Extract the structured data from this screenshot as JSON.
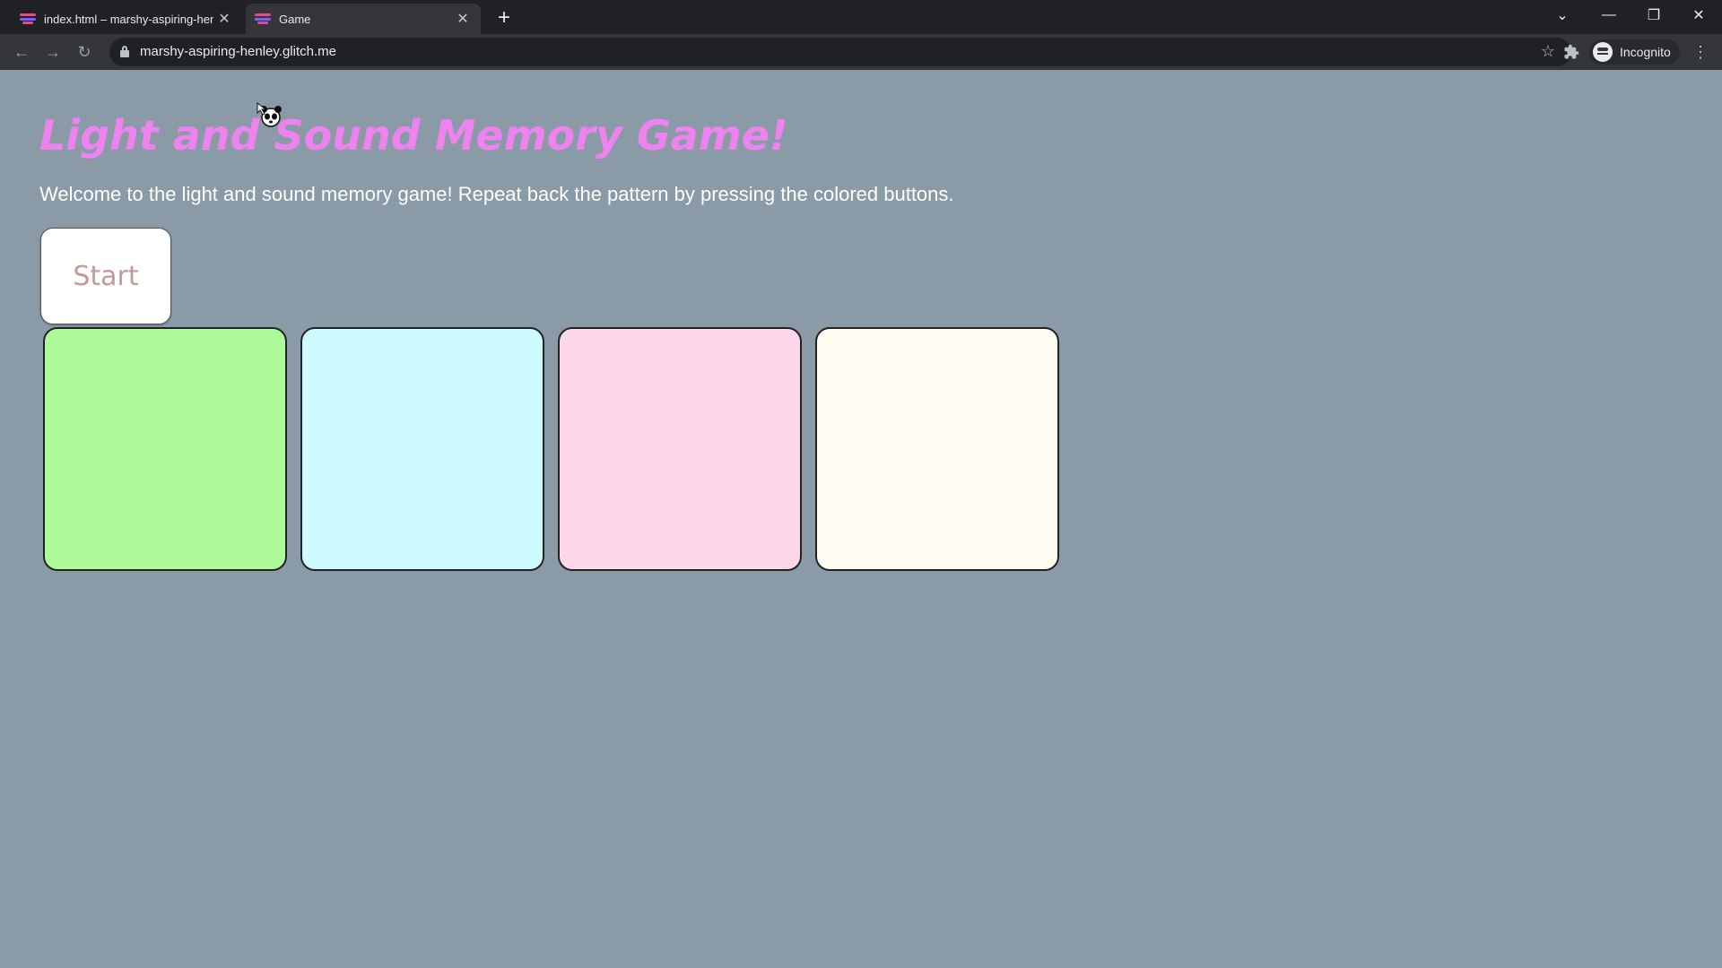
{
  "browser": {
    "tabs": [
      {
        "title": "index.html – marshy-aspiring-henley",
        "active": false
      },
      {
        "title": "Game",
        "active": true
      }
    ],
    "url": "marshy-aspiring-henley.glitch.me",
    "profile_label": "Incognito",
    "icons": {
      "close": "✕",
      "new_tab": "+",
      "back": "←",
      "forward": "→",
      "reload": "↻",
      "star": "☆",
      "extensions": "puzzle-icon",
      "menu": "⋮",
      "tab_search": "⌄",
      "minimize": "—",
      "restore": "❐",
      "window_close": "✕"
    }
  },
  "game": {
    "title": "Light and Sound Memory Game!",
    "intro": "Welcome to the light and sound memory game! Repeat back the pattern by pressing the colored buttons.",
    "start_label": "Start",
    "buttons": [
      {
        "name": "green",
        "color": "#adfa9b"
      },
      {
        "name": "cyan",
        "color": "#cdfbff"
      },
      {
        "name": "pink",
        "color": "#fcd7ea"
      },
      {
        "name": "cream",
        "color": "#fefcf0"
      }
    ]
  },
  "colors": {
    "page_background": "#8a9aa6",
    "title": "#ee82ee",
    "start_text": "#c29a98"
  }
}
